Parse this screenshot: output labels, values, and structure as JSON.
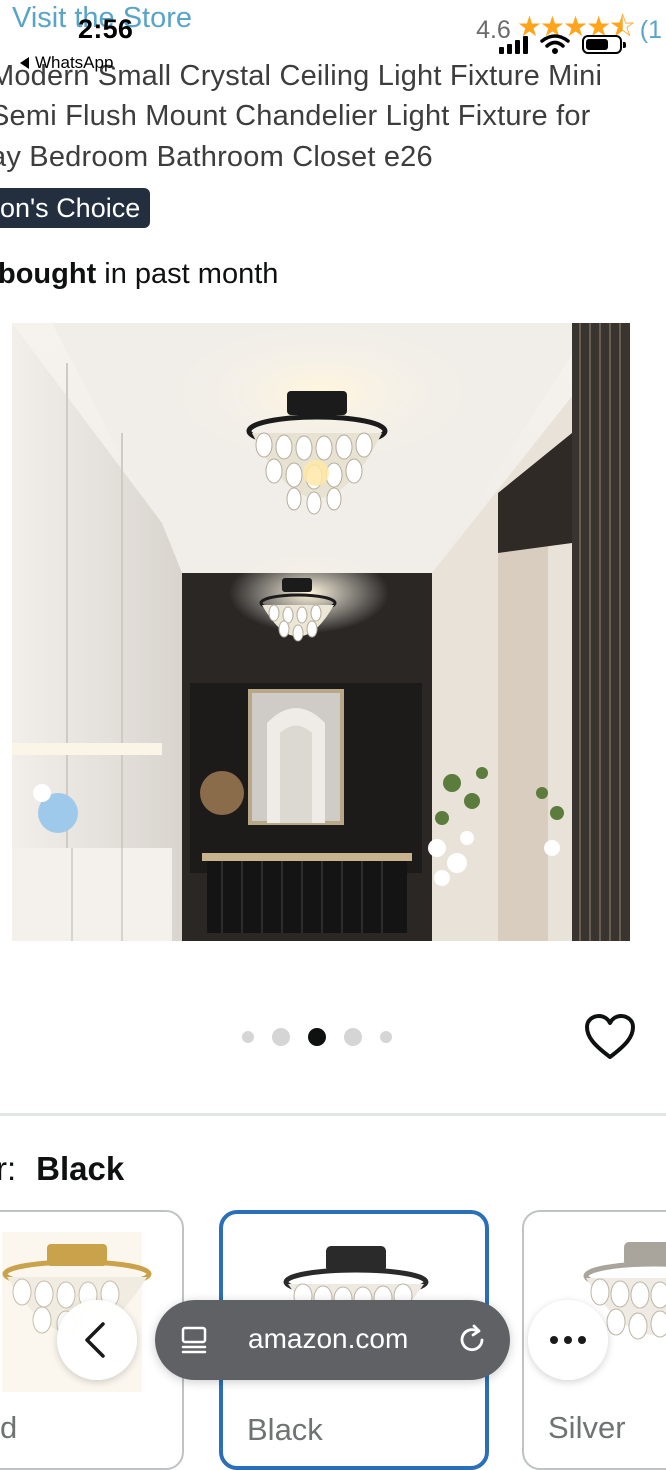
{
  "status_bar": {
    "time": "2:56",
    "back_app": "WhatsApp"
  },
  "store_link": "Visit the Store",
  "rating": {
    "value": "4.6",
    "stars": 4.6,
    "count_prefix": "(1"
  },
  "title_lines": [
    " Modern Small Crystal Ceiling Light Fixture Mini",
    "Semi Flush Mount Chandelier Light Fixture for",
    "ay Bedroom Bathroom Closet e26"
  ],
  "badge": "on's Choice",
  "bought": {
    "bold": "bought",
    "rest": " in past month"
  },
  "carousel": {
    "dot_count": 5,
    "active_index": 2
  },
  "color_selector": {
    "label": "r:",
    "selected": "Black",
    "options": [
      "d",
      "Black",
      "Silver"
    ]
  },
  "browser": {
    "url": "amazon.com"
  },
  "colors": {
    "link": "#5aa4c8",
    "star": "#ffa41c",
    "badge_bg": "#232f3e",
    "selected_border": "#2a6fb8"
  }
}
